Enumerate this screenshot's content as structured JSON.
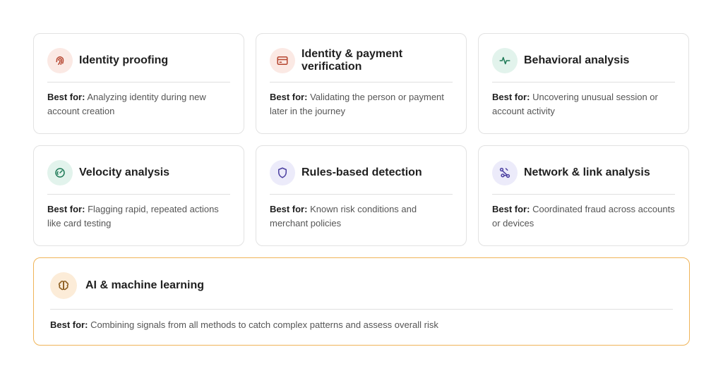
{
  "best_for_label": "Best for:",
  "cards": [
    {
      "title": "Identity proofing",
      "icon": "fingerprint-icon",
      "text": "Analyzing identity during new account creation"
    },
    {
      "title": "Identity & payment verification",
      "icon": "credit-card-icon",
      "text": "Validating the person or payment later in the journey"
    },
    {
      "title": "Behavioral analysis",
      "icon": "activity-pulse-icon",
      "text": "Uncovering unusual session or account activity"
    },
    {
      "title": "Velocity analysis",
      "icon": "speedometer-icon",
      "text": "Flagging rapid, repeated actions like card testing"
    },
    {
      "title": "Rules-based detection",
      "icon": "shield-icon",
      "text": "Known risk conditions and merchant policies"
    },
    {
      "title": "Network & link analysis",
      "icon": "network-nodes-icon",
      "text": "Coordinated fraud across accounts or devices"
    }
  ],
  "featured": {
    "title": "AI & machine learning",
    "icon": "brain-icon",
    "text": "Combining signals from all methods to catch complex patterns and assess overall risk"
  },
  "colors": {
    "rose_icon": "#b5452f",
    "mint_icon": "#1f7a57",
    "lavender_icon": "#4b3fa0",
    "sand_icon": "#8a5a1c",
    "featured_border": "#f0b458"
  }
}
